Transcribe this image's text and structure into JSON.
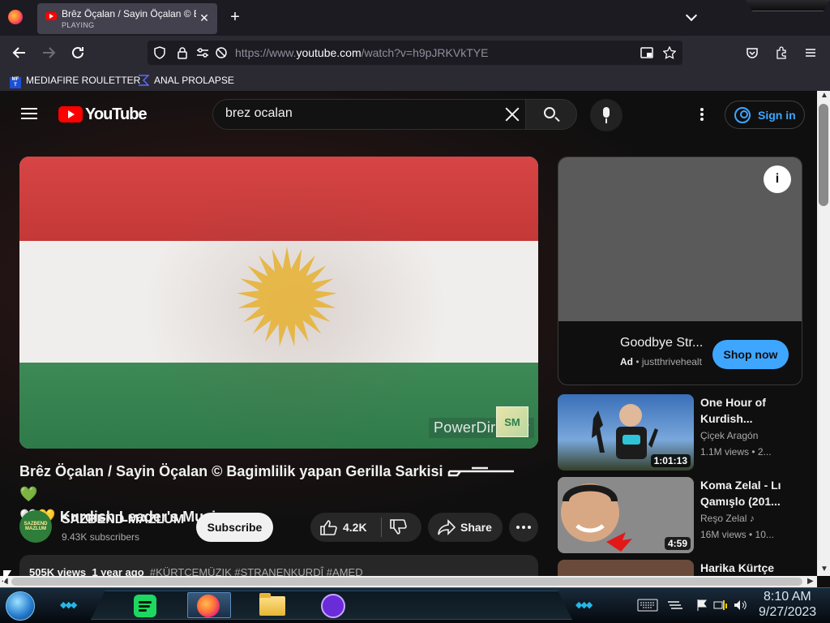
{
  "browser": {
    "tab": {
      "title": "Brêz Öçalan / Sayin Öçalan © B",
      "subtitle": "PLAYING",
      "close": "✕"
    },
    "new_tab": "+",
    "url": {
      "prefix": "https://www.",
      "domain": "youtube.com",
      "path": "/watch?v=h9pJRKVkTYE"
    },
    "bookmarks": [
      {
        "label": "MEDIAFIRE ROULETTER",
        "icon": "mf-icon"
      },
      {
        "label": "ANAL PROLAPSE",
        "icon": "sigma-icon"
      }
    ]
  },
  "youtube": {
    "logo_text": "YouTube",
    "search_value": "brez ocalan",
    "sign_in": "Sign in",
    "player": {
      "watermark": "PowerDirector",
      "logo_text": "SM"
    },
    "video": {
      "title_part1": "Brêz Öçalan / Sayin Öçalan © Bagimlilik yapan Gerilla Sarkisi ",
      "title_heart": " 💚",
      "title_line2": "🤍💛 Kurdish Leader's Music",
      "channel_name": "SAZBEND MAZLUM",
      "channel_avatar_text": "SAZBEND MAZLUM",
      "subscribers": "9.43K subscribers",
      "subscribe_label": "Subscribe",
      "like_count": "4.2K",
      "share_label": "Share",
      "views": "505K views",
      "age": "1 year ago",
      "tags": "#KÜRTÇEMÜZIK #STRANENKURDÎ #AMED"
    },
    "ad": {
      "title": "Goodbye Str...",
      "badge": "Ad",
      "advertiser": "justthrivehealt",
      "cta": "Shop now",
      "info": "i"
    },
    "recommendations": [
      {
        "title_line1": "One Hour of",
        "title_line2": "Kurdish...",
        "channel": "Çiçek Aragón",
        "stats": "1.1M views  •  2...",
        "duration": "1:01:13"
      },
      {
        "title_line1": "Koma Zelal - Lı",
        "title_line2": "Qamışlo (201...",
        "channel": "Reşo Zelal  ♪",
        "stats": "16M views  •  10...",
        "duration": "4:59"
      },
      {
        "title_line1": "Harika Kürtçe",
        "title_line2": "",
        "channel": "",
        "stats": "",
        "duration": ""
      }
    ]
  },
  "taskbar": {
    "time": "8:10 AM",
    "date": "9/27/2023"
  },
  "colors": {
    "youtube_red": "#ff0000",
    "link_blue": "#3ea6ff",
    "background": "#0f0f0f",
    "firefox_chrome": "#2b2a33"
  }
}
